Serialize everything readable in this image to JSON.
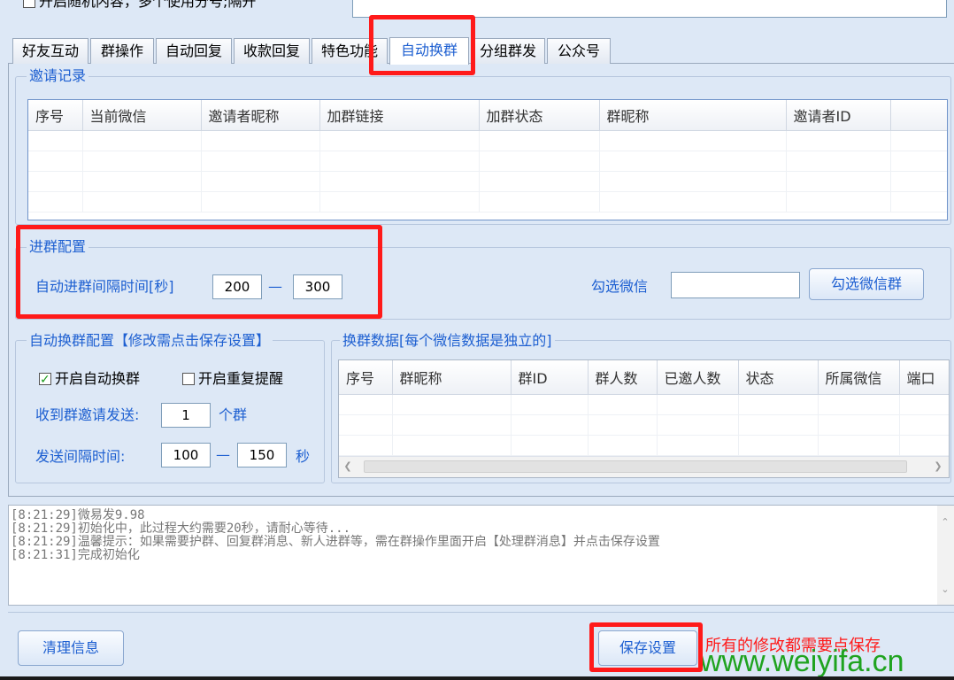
{
  "top": {
    "random_content_label": "开启随机内容，多个使用分号;隔开"
  },
  "tabs": [
    "好友互动",
    "群操作",
    "自动回复",
    "收款回复",
    "特色功能",
    "自动换群",
    "分组群发",
    "公众号"
  ],
  "invite_records": {
    "title": "邀请记录",
    "columns": [
      "序号",
      "当前微信",
      "邀请者昵称",
      "加群链接",
      "加群状态",
      "群昵称",
      "邀请者ID"
    ]
  },
  "join_config": {
    "title": "进群配置",
    "interval_label": "自动进群间隔时间[秒]",
    "interval_min": "200",
    "dash": "—",
    "interval_max": "300",
    "select_wechat_label": "勾选微信",
    "select_wechat_value": "",
    "select_groups_button": "勾选微信群"
  },
  "auto_swap_config": {
    "title": "自动换群配置【修改需点击保存设置】",
    "enable_auto_swap": "开启自动换群",
    "enable_auto_swap_checked": true,
    "enable_repeat_remind": "开启重复提醒",
    "enable_repeat_remind_checked": false,
    "receive_invite_label": "收到群邀请发送:",
    "receive_invite_value": "1",
    "receive_invite_unit": "个群",
    "send_interval_label": "发送间隔时间:",
    "send_interval_min": "100",
    "dash": "—",
    "send_interval_max": "150",
    "send_interval_unit": "秒"
  },
  "swap_data": {
    "title": "换群数据[每个微信数据是独立的]",
    "columns": [
      "序号",
      "群昵称",
      "群ID",
      "群人数",
      "已邀人数",
      "状态",
      "所属微信",
      "端口"
    ]
  },
  "log": {
    "lines": [
      "[8:21:29]微易发9.98",
      "[8:21:29]初始化中，此过程大约需要20秒，请耐心等待...",
      "[8:21:29]温馨提示：如果需要护群、回复群消息、新人进群等，需在群操作里面开启【处理群消息】并点击保存设置",
      "[8:21:31]完成初始化"
    ]
  },
  "bottom": {
    "clear_button": "清理信息",
    "save_button": "保存设置",
    "save_hint": "所有的修改都需要点保存",
    "watermark": "www.weiyifa.cn"
  },
  "colors": {
    "background": "#dde8f6",
    "accent_blue": "#1d5fd1",
    "highlight_red": "#ff1a1a",
    "watermark_green": "#1fa31f"
  }
}
